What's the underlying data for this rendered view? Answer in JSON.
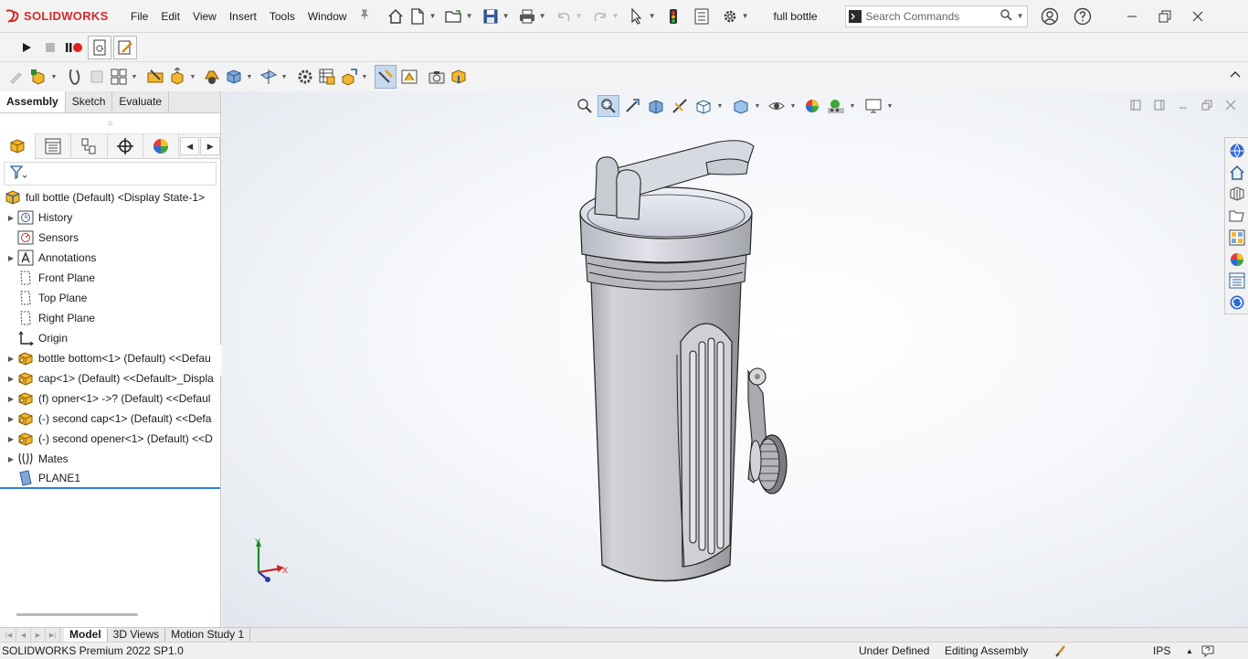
{
  "app": {
    "brand_ds": "3S",
    "brand_name": "SOLIDWORKS"
  },
  "menu": [
    "File",
    "Edit",
    "View",
    "Insert",
    "Tools",
    "Window"
  ],
  "document_title": "full bottle",
  "search": {
    "placeholder": "Search Commands"
  },
  "command_manager_tabs": [
    {
      "label": "Assembly",
      "active": true
    },
    {
      "label": "Sketch",
      "active": false
    },
    {
      "label": "Evaluate",
      "active": false
    }
  ],
  "feature_tree": {
    "root": "full bottle (Default) <Display State-1>",
    "items": [
      {
        "label": "History",
        "icon": "history-icon",
        "expandable": true
      },
      {
        "label": "Sensors",
        "icon": "sensors-icon",
        "expandable": false
      },
      {
        "label": "Annotations",
        "icon": "annotations-icon",
        "expandable": true
      },
      {
        "label": "Front Plane",
        "icon": "plane-icon",
        "expandable": false
      },
      {
        "label": "Top Plane",
        "icon": "plane-icon",
        "expandable": false
      },
      {
        "label": "Right Plane",
        "icon": "plane-icon",
        "expandable": false
      },
      {
        "label": "Origin",
        "icon": "origin-icon",
        "expandable": false
      },
      {
        "label": "bottle bottom<1> (Default) <<Defau",
        "icon": "part-icon",
        "expandable": true
      },
      {
        "label": "cap<1> (Default) <<Default>_Displa",
        "icon": "part-icon",
        "expandable": true
      },
      {
        "label": "(f) opner<1> ->? (Default) <<Defaul",
        "icon": "part-icon",
        "expandable": true
      },
      {
        "label": "(-) second cap<1> (Default) <<Defa",
        "icon": "part-icon",
        "expandable": true
      },
      {
        "label": "(-) second opener<1> (Default) <<D",
        "icon": "part-icon",
        "expandable": true
      },
      {
        "label": "Mates",
        "icon": "mates-icon",
        "expandable": true
      },
      {
        "label": "PLANE1",
        "icon": "plane-solid-icon",
        "expandable": false
      }
    ]
  },
  "triad": {
    "y": "Y",
    "x": "X"
  },
  "bottom_tabs": [
    {
      "label": "Model",
      "active": true
    },
    {
      "label": "3D Views",
      "active": false
    },
    {
      "label": "Motion Study 1",
      "active": false
    }
  ],
  "status": {
    "product": "SOLIDWORKS Premium 2022 SP1.0",
    "definition": "Under Defined",
    "mode": "Editing Assembly",
    "units": "IPS"
  },
  "colors": {
    "brand_red": "#d42a2a",
    "selection_blue": "#2c7fd0",
    "part_yellow": "#f2b630"
  }
}
